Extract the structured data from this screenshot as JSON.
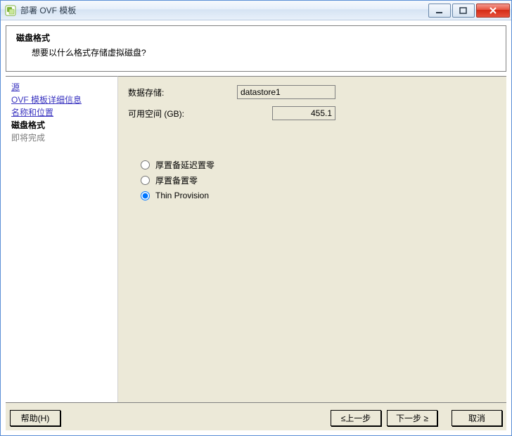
{
  "window": {
    "title": "部署 OVF 模板"
  },
  "header": {
    "title": "磁盘格式",
    "subtitle": "想要以什么格式存储虚拟磁盘?"
  },
  "sidebar": {
    "items": [
      {
        "label": "源",
        "state": "link"
      },
      {
        "label": "OVF 模板详细信息",
        "state": "link"
      },
      {
        "label": "名称和位置",
        "state": "link"
      },
      {
        "label": "磁盘格式",
        "state": "current"
      },
      {
        "label": "即将完成",
        "state": "disabled"
      }
    ]
  },
  "content": {
    "datastore_label": "数据存储:",
    "datastore_value": "datastore1",
    "free_label": "可用空间 (GB):",
    "free_value": "455.1",
    "options": [
      {
        "label": "厚置备延迟置零",
        "selected": false
      },
      {
        "label": "厚置备置零",
        "selected": false
      },
      {
        "label": "Thin Provision",
        "selected": true
      }
    ]
  },
  "footer": {
    "help": "帮助(H)",
    "back": "≤上一步",
    "next": "下一步 ≥",
    "cancel": "取消"
  }
}
